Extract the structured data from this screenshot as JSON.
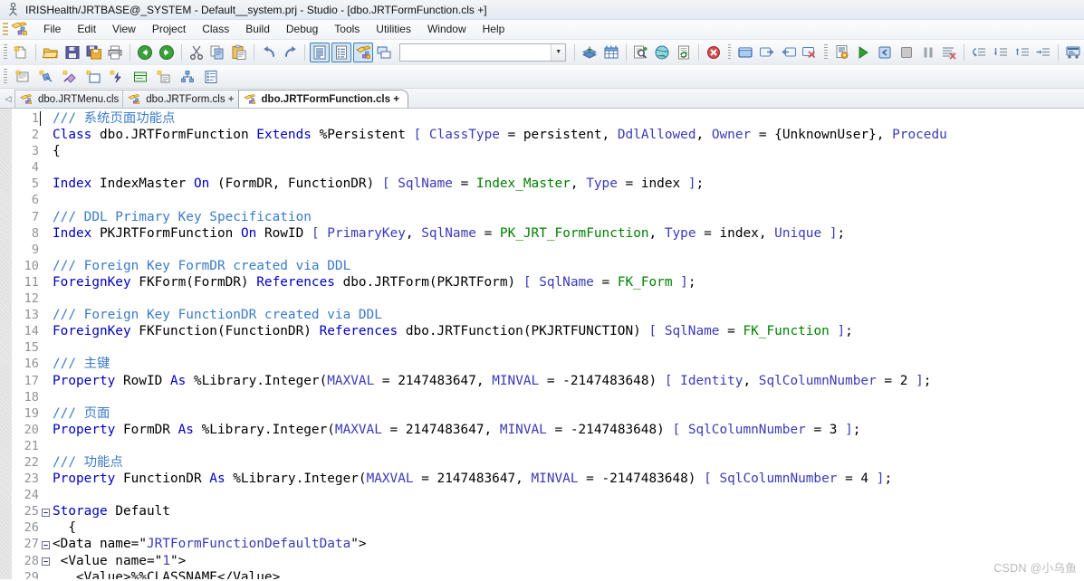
{
  "window": {
    "title": "IRISHealth/JRTBASE@_SYSTEM - Default__system.prj - Studio - [dbo.JRTFormFunction.cls +]",
    "app_icon": "studio-app-icon"
  },
  "menubar": {
    "items": [
      {
        "label": "File",
        "name": "menu-file"
      },
      {
        "label": "Edit",
        "name": "menu-edit"
      },
      {
        "label": "View",
        "name": "menu-view"
      },
      {
        "label": "Project",
        "name": "menu-project"
      },
      {
        "label": "Class",
        "name": "menu-class"
      },
      {
        "label": "Build",
        "name": "menu-build"
      },
      {
        "label": "Debug",
        "name": "menu-debug"
      },
      {
        "label": "Tools",
        "name": "menu-tools"
      },
      {
        "label": "Utilities",
        "name": "menu-utilities"
      },
      {
        "label": "Window",
        "name": "menu-window"
      },
      {
        "label": "Help",
        "name": "menu-help"
      }
    ]
  },
  "toolbar_main": {
    "combo_value": "",
    "combo_placeholder": "",
    "buttons": [
      {
        "name": "new-file-button",
        "icon": "new-document-icon"
      },
      {
        "name": "open-project-button",
        "icon": "open-folder-icon"
      },
      {
        "name": "open-file-button",
        "icon": "open-folder-icon"
      },
      {
        "name": "save-button",
        "icon": "floppy-save-icon"
      },
      {
        "name": "save-all-button",
        "icon": "floppy-save-all-icon"
      },
      {
        "name": "print-button",
        "icon": "printer-icon"
      },
      {
        "name": "navigate-back-button",
        "icon": "arrow-left-icon"
      },
      {
        "name": "navigate-forward-button",
        "icon": "arrow-right-icon"
      },
      {
        "name": "cut-button",
        "icon": "scissors-icon"
      },
      {
        "name": "copy-button",
        "icon": "copy-icon"
      },
      {
        "name": "paste-button",
        "icon": "clipboard-paste-icon"
      },
      {
        "name": "undo-button",
        "icon": "undo-arrow-icon"
      },
      {
        "name": "redo-button",
        "icon": "redo-arrow-icon"
      },
      {
        "name": "view-source-button",
        "icon": "document-lines-icon"
      },
      {
        "name": "view-inspector-button",
        "icon": "document-inspector-icon"
      },
      {
        "name": "view-class-button",
        "icon": "class-editor-icon"
      },
      {
        "name": "view-split-button",
        "icon": "split-window-icon"
      },
      {
        "name": "compile-package-button",
        "icon": "package-compile-icon"
      },
      {
        "name": "grid-view-button",
        "icon": "grid-table-icon"
      },
      {
        "name": "find-in-files-button",
        "icon": "magnifier-document-icon"
      },
      {
        "name": "web-page-button",
        "icon": "globe-icon"
      },
      {
        "name": "refresh-document-button",
        "icon": "refresh-document-icon"
      },
      {
        "name": "stop-button",
        "icon": "stop-error-icon"
      },
      {
        "name": "output-window-button",
        "icon": "window-blue-icon"
      },
      {
        "name": "dock-right-button",
        "icon": "window-dock-right-icon"
      },
      {
        "name": "dock-left-button",
        "icon": "window-dock-left-icon"
      },
      {
        "name": "close-window-button",
        "icon": "window-close-icon"
      },
      {
        "name": "compile-button",
        "icon": "compile-gear-icon"
      },
      {
        "name": "run-button",
        "icon": "run-play-icon"
      },
      {
        "name": "step-into-button",
        "icon": "step-into-icon"
      },
      {
        "name": "stop-debug-button",
        "icon": "stop-square-icon"
      },
      {
        "name": "pause-debug-button",
        "icon": "pause-icon"
      },
      {
        "name": "clear-breakpoints-button",
        "icon": "clear-list-icon"
      },
      {
        "name": "step-over-button",
        "icon": "step-over-icon"
      },
      {
        "name": "step-out-button",
        "icon": "step-out-icon"
      },
      {
        "name": "run-to-cursor-button",
        "icon": "run-to-cursor-icon"
      },
      {
        "name": "goto-line-button",
        "icon": "goto-line-icon"
      },
      {
        "name": "web-terminal-button",
        "icon": "terminal-icon"
      }
    ]
  },
  "toolbar_secondary": {
    "buttons": [
      {
        "name": "new-class-button",
        "icon": "new-class-icon"
      },
      {
        "name": "new-property-button",
        "icon": "new-property-icon"
      },
      {
        "name": "new-method-button",
        "icon": "new-method-icon"
      },
      {
        "name": "new-parameter-button",
        "icon": "new-parameter-icon"
      },
      {
        "name": "new-index-button",
        "icon": "new-index-icon"
      },
      {
        "name": "new-query-button",
        "icon": "new-query-icon"
      },
      {
        "name": "new-xdata-button",
        "icon": "new-xdata-icon"
      },
      {
        "name": "new-projection-button",
        "icon": "new-projection-icon"
      },
      {
        "name": "class-members-button",
        "icon": "class-members-icon"
      }
    ]
  },
  "tabs": {
    "scroll_left_icon": "chevron-left-icon",
    "items": [
      {
        "label": "dbo.JRTMenu.cls",
        "active": false,
        "modified": false,
        "name": "tab-dbo-jrtmenu"
      },
      {
        "label": "dbo.JRTForm.cls +",
        "active": false,
        "modified": true,
        "name": "tab-dbo-jrtform"
      },
      {
        "label": "dbo.JRTFormFunction.cls +",
        "active": true,
        "modified": true,
        "name": "tab-dbo-jrtformfunction"
      }
    ]
  },
  "editor": {
    "caret_line": 1,
    "colors": {
      "keyword": "#0000c0",
      "comment": "#3b7bc8",
      "identifier_green": "#008000",
      "attribute": "#3a3ab8",
      "line_number": "#8f9399",
      "background": "#ffffff"
    },
    "lines": [
      {
        "n": 1,
        "fold": "",
        "tokens": [
          {
            "t": "/// ",
            "c": "cmt"
          },
          {
            "t": "系统页面功能点",
            "c": "cmt"
          }
        ]
      },
      {
        "n": 2,
        "fold": "",
        "tokens": [
          {
            "t": "Class",
            "c": "kw"
          },
          {
            "t": " dbo.JRTFormFunction ",
            "c": "plain"
          },
          {
            "t": "Extends",
            "c": "kw"
          },
          {
            "t": " %Persistent ",
            "c": "plain"
          },
          {
            "t": "[",
            "c": "attr"
          },
          {
            "t": " ",
            "c": "plain"
          },
          {
            "t": "ClassType",
            "c": "attr"
          },
          {
            "t": " = persistent, ",
            "c": "plain"
          },
          {
            "t": "DdlAllowed",
            "c": "attr"
          },
          {
            "t": ", ",
            "c": "plain"
          },
          {
            "t": "Owner",
            "c": "attr"
          },
          {
            "t": " = {UnknownUser}, ",
            "c": "plain"
          },
          {
            "t": "Procedu",
            "c": "attr"
          }
        ]
      },
      {
        "n": 3,
        "fold": "",
        "tokens": [
          {
            "t": "{",
            "c": "plain"
          }
        ]
      },
      {
        "n": 4,
        "fold": "",
        "tokens": []
      },
      {
        "n": 5,
        "fold": "",
        "tokens": [
          {
            "t": "Index",
            "c": "kw"
          },
          {
            "t": " IndexMaster ",
            "c": "plain"
          },
          {
            "t": "On",
            "c": "kw"
          },
          {
            "t": " (FormDR, FunctionDR) ",
            "c": "plain"
          },
          {
            "t": "[",
            "c": "attr"
          },
          {
            "t": " ",
            "c": "plain"
          },
          {
            "t": "SqlName",
            "c": "attr"
          },
          {
            "t": " = ",
            "c": "plain"
          },
          {
            "t": "Index_Master",
            "c": "id"
          },
          {
            "t": ", ",
            "c": "plain"
          },
          {
            "t": "Type",
            "c": "attr"
          },
          {
            "t": " = index ",
            "c": "plain"
          },
          {
            "t": "]",
            "c": "attr"
          },
          {
            "t": ";",
            "c": "plain"
          }
        ]
      },
      {
        "n": 6,
        "fold": "",
        "tokens": []
      },
      {
        "n": 7,
        "fold": "",
        "tokens": [
          {
            "t": "/// DDL Primary Key Specification",
            "c": "cmt"
          }
        ]
      },
      {
        "n": 8,
        "fold": "",
        "tokens": [
          {
            "t": "Index",
            "c": "kw"
          },
          {
            "t": " PKJRTFormFunction ",
            "c": "plain"
          },
          {
            "t": "On",
            "c": "kw"
          },
          {
            "t": " RowID ",
            "c": "plain"
          },
          {
            "t": "[",
            "c": "attr"
          },
          {
            "t": " ",
            "c": "plain"
          },
          {
            "t": "PrimaryKey",
            "c": "attr"
          },
          {
            "t": ", ",
            "c": "plain"
          },
          {
            "t": "SqlName",
            "c": "attr"
          },
          {
            "t": " = ",
            "c": "plain"
          },
          {
            "t": "PK_JRT_FormFunction",
            "c": "id"
          },
          {
            "t": ", ",
            "c": "plain"
          },
          {
            "t": "Type",
            "c": "attr"
          },
          {
            "t": " = index, ",
            "c": "plain"
          },
          {
            "t": "Unique",
            "c": "attr"
          },
          {
            "t": " ",
            "c": "plain"
          },
          {
            "t": "]",
            "c": "attr"
          },
          {
            "t": ";",
            "c": "plain"
          }
        ]
      },
      {
        "n": 9,
        "fold": "",
        "tokens": []
      },
      {
        "n": 10,
        "fold": "",
        "tokens": [
          {
            "t": "/// Foreign Key FormDR created via DDL",
            "c": "cmt"
          }
        ]
      },
      {
        "n": 11,
        "fold": "",
        "tokens": [
          {
            "t": "ForeignKey",
            "c": "kw"
          },
          {
            "t": " FKForm(FormDR) ",
            "c": "plain"
          },
          {
            "t": "References",
            "c": "kw"
          },
          {
            "t": " dbo.JRTForm(PKJRTForm) ",
            "c": "plain"
          },
          {
            "t": "[",
            "c": "attr"
          },
          {
            "t": " ",
            "c": "plain"
          },
          {
            "t": "SqlName",
            "c": "attr"
          },
          {
            "t": " = ",
            "c": "plain"
          },
          {
            "t": "FK_Form",
            "c": "id"
          },
          {
            "t": " ",
            "c": "plain"
          },
          {
            "t": "]",
            "c": "attr"
          },
          {
            "t": ";",
            "c": "plain"
          }
        ]
      },
      {
        "n": 12,
        "fold": "",
        "tokens": []
      },
      {
        "n": 13,
        "fold": "",
        "tokens": [
          {
            "t": "/// Foreign Key FunctionDR created via DDL",
            "c": "cmt"
          }
        ]
      },
      {
        "n": 14,
        "fold": "",
        "tokens": [
          {
            "t": "ForeignKey",
            "c": "kw"
          },
          {
            "t": " FKFunction(FunctionDR) ",
            "c": "plain"
          },
          {
            "t": "References",
            "c": "kw"
          },
          {
            "t": " dbo.JRTFunction(PKJRTFUNCTION) ",
            "c": "plain"
          },
          {
            "t": "[",
            "c": "attr"
          },
          {
            "t": " ",
            "c": "plain"
          },
          {
            "t": "SqlName",
            "c": "attr"
          },
          {
            "t": " = ",
            "c": "plain"
          },
          {
            "t": "FK_Function",
            "c": "id"
          },
          {
            "t": " ",
            "c": "plain"
          },
          {
            "t": "]",
            "c": "attr"
          },
          {
            "t": ";",
            "c": "plain"
          }
        ]
      },
      {
        "n": 15,
        "fold": "",
        "tokens": []
      },
      {
        "n": 16,
        "fold": "",
        "tokens": [
          {
            "t": "/// 主键",
            "c": "cmt"
          }
        ]
      },
      {
        "n": 17,
        "fold": "",
        "tokens": [
          {
            "t": "Property",
            "c": "kw"
          },
          {
            "t": " RowID ",
            "c": "plain"
          },
          {
            "t": "As",
            "c": "kw"
          },
          {
            "t": " %Library.Integer(",
            "c": "plain"
          },
          {
            "t": "MAXVAL",
            "c": "attr"
          },
          {
            "t": " = 2147483647, ",
            "c": "plain"
          },
          {
            "t": "MINVAL",
            "c": "attr"
          },
          {
            "t": " = -2147483648) ",
            "c": "plain"
          },
          {
            "t": "[",
            "c": "attr"
          },
          {
            "t": " ",
            "c": "plain"
          },
          {
            "t": "Identity",
            "c": "attr"
          },
          {
            "t": ", ",
            "c": "plain"
          },
          {
            "t": "SqlColumnNumber",
            "c": "attr"
          },
          {
            "t": " = 2 ",
            "c": "plain"
          },
          {
            "t": "]",
            "c": "attr"
          },
          {
            "t": ";",
            "c": "plain"
          }
        ]
      },
      {
        "n": 18,
        "fold": "",
        "tokens": []
      },
      {
        "n": 19,
        "fold": "",
        "tokens": [
          {
            "t": "/// 页面",
            "c": "cmt"
          }
        ]
      },
      {
        "n": 20,
        "fold": "",
        "tokens": [
          {
            "t": "Property",
            "c": "kw"
          },
          {
            "t": " FormDR ",
            "c": "plain"
          },
          {
            "t": "As",
            "c": "kw"
          },
          {
            "t": " %Library.Integer(",
            "c": "plain"
          },
          {
            "t": "MAXVAL",
            "c": "attr"
          },
          {
            "t": " = 2147483647, ",
            "c": "plain"
          },
          {
            "t": "MINVAL",
            "c": "attr"
          },
          {
            "t": " = -2147483648) ",
            "c": "plain"
          },
          {
            "t": "[",
            "c": "attr"
          },
          {
            "t": " ",
            "c": "plain"
          },
          {
            "t": "SqlColumnNumber",
            "c": "attr"
          },
          {
            "t": " = 3 ",
            "c": "plain"
          },
          {
            "t": "]",
            "c": "attr"
          },
          {
            "t": ";",
            "c": "plain"
          }
        ]
      },
      {
        "n": 21,
        "fold": "",
        "tokens": []
      },
      {
        "n": 22,
        "fold": "",
        "tokens": [
          {
            "t": "/// 功能点",
            "c": "cmt"
          }
        ]
      },
      {
        "n": 23,
        "fold": "",
        "tokens": [
          {
            "t": "Property",
            "c": "kw"
          },
          {
            "t": " FunctionDR ",
            "c": "plain"
          },
          {
            "t": "As",
            "c": "kw"
          },
          {
            "t": " %Library.Integer(",
            "c": "plain"
          },
          {
            "t": "MAXVAL",
            "c": "attr"
          },
          {
            "t": " = 2147483647, ",
            "c": "plain"
          },
          {
            "t": "MINVAL",
            "c": "attr"
          },
          {
            "t": " = -2147483648) ",
            "c": "plain"
          },
          {
            "t": "[",
            "c": "attr"
          },
          {
            "t": " ",
            "c": "plain"
          },
          {
            "t": "SqlColumnNumber",
            "c": "attr"
          },
          {
            "t": " = 4 ",
            "c": "plain"
          },
          {
            "t": "]",
            "c": "attr"
          },
          {
            "t": ";",
            "c": "plain"
          }
        ]
      },
      {
        "n": 24,
        "fold": "",
        "tokens": []
      },
      {
        "n": 25,
        "fold": "−",
        "tokens": [
          {
            "t": "Storage",
            "c": "kw"
          },
          {
            "t": " Default",
            "c": "plain"
          }
        ]
      },
      {
        "n": 26,
        "fold": "",
        "tokens": [
          {
            "t": "  {",
            "c": "plain"
          }
        ]
      },
      {
        "n": 27,
        "fold": "−",
        "tokens": [
          {
            "t": "<Data name=",
            "c": "plain"
          },
          {
            "t": "\"",
            "c": "plain"
          },
          {
            "t": "JRTFormFunctionDefaultData",
            "c": "str"
          },
          {
            "t": "\">",
            "c": "plain"
          }
        ]
      },
      {
        "n": 28,
        "fold": "−",
        "tokens": [
          {
            "t": " <Value name=",
            "c": "plain"
          },
          {
            "t": "\"",
            "c": "plain"
          },
          {
            "t": "1",
            "c": "str"
          },
          {
            "t": "\">",
            "c": "plain"
          }
        ]
      },
      {
        "n": 29,
        "fold": "",
        "tokens": [
          {
            "t": "   <Value>%%CLASSNAME</Value>",
            "c": "plain"
          }
        ]
      }
    ]
  },
  "watermark": {
    "text": "CSDN @小乌鱼"
  }
}
